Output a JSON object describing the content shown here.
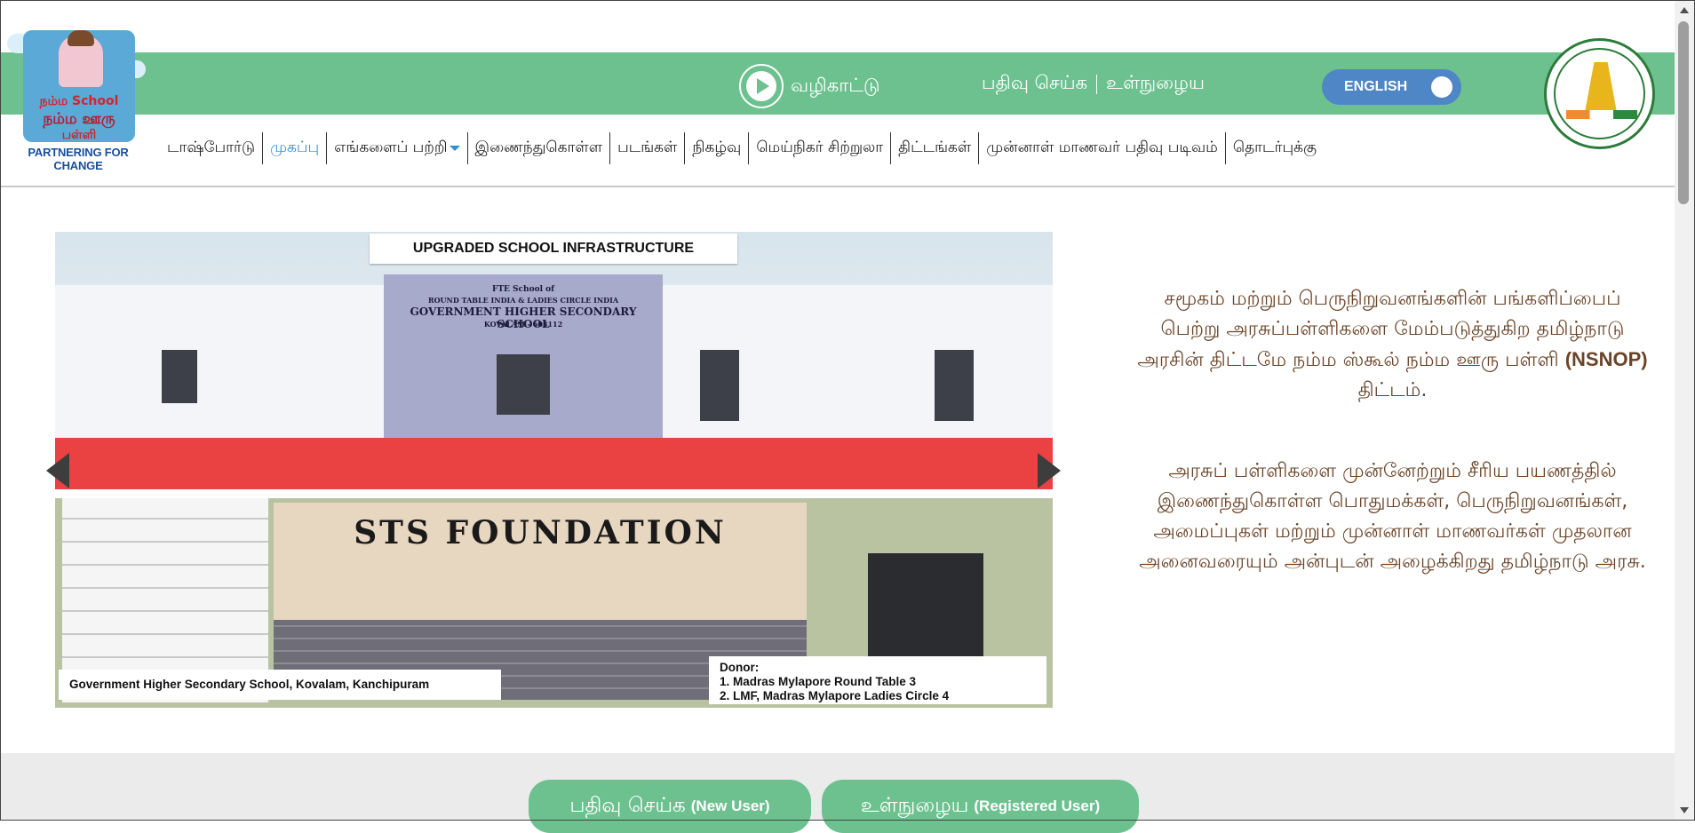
{
  "header": {
    "logo": {
      "line1": "நம்ம School",
      "line2": "நம்ம ஊரு",
      "line3": "பள்ளி"
    },
    "partnering": "PARTNERING FOR CHANGE",
    "guide_label": "வழிகாட்டு",
    "register_label": "பதிவு செய்க",
    "login_label": "உள்நுழைய",
    "language_toggle": "ENGLISH",
    "emblem_name": "tamil-nadu-emblem"
  },
  "nav": {
    "items": [
      {
        "label": "டாஷ்போர்டு"
      },
      {
        "label": "முகப்பு"
      },
      {
        "label": "எங்களைப் பற்றி"
      },
      {
        "label": "இணைந்துகொள்ள"
      },
      {
        "label": "படங்கள்"
      },
      {
        "label": "நிகழ்வு"
      },
      {
        "label": "மெய்நிகர் சிற்றுலா"
      },
      {
        "label": "திட்டங்கள்"
      },
      {
        "label": "முன்னாள் மாணவர் பதிவு படிவம்"
      },
      {
        "label": "தொடர்புக்கு"
      }
    ],
    "active_index": 1
  },
  "banner": {
    "title": "UPGRADED SCHOOL INFRASTRUCTURE",
    "sign_line1": "FTE School of",
    "sign_line2": "ROUND TABLE INDIA & LADIES CIRCLE INDIA",
    "sign_line3": "GOVERNMENT HIGHER SECONDARY SCHOOL",
    "sign_line4": "KOVALAM - 603112",
    "foundation": "STS FOUNDATION",
    "caption": "Government Higher Secondary School, Kovalam, Kanchipuram",
    "donor_heading": "Donor:",
    "donor_1": "1. Madras Mylapore Round Table 3",
    "donor_2": "2. LMF, Madras Mylapore Ladies Circle 4"
  },
  "description": {
    "para1_text": "சமூகம் மற்றும் பெருநிறுவனங்களின் பங்களிப்பைப் பெற்று அரசுப்பள்ளிகளை மேம்படுத்துகிற தமிழ்நாடு அரசின் திட்டமே நம்ம ஸ்கூல் நம்ம ஊரு பள்ளி",
    "para1_bold": "(NSNOP)",
    "para1_end": "திட்டம்.",
    "para2": "அரசுப் பள்ளிகளை முன்னேற்றும் சீரிய பயணத்தில் இணைந்துகொள்ள பொதுமக்கள், பெருநிறுவனங்கள், அமைப்புகள் மற்றும் முன்னாள் மாணவர்கள் முதலான அனைவரையும் அன்புடன் அழைக்கிறது தமிழ்நாடு அரசு."
  },
  "actions": {
    "register_label": "பதிவு செய்க",
    "register_sub": "(New User)",
    "login_label": "உள்நுழைய",
    "login_sub": "(Registered User)"
  },
  "colors": {
    "brand_green": "#6cc18f",
    "toggle_blue": "#4e86c6",
    "active_nav": "#2d8fd6",
    "text_brown": "#6b4428"
  }
}
